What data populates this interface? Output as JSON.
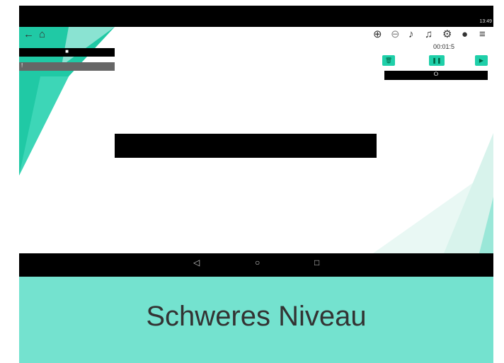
{
  "status_bar": {
    "time": "13:49"
  },
  "toolbar": {
    "timer": "00:01:5",
    "left_bar1_mark": "■",
    "left_bar2_mark": "!",
    "right_bar_mark": "⭘",
    "icons": [
      "back-arrow-icon",
      "home-icon",
      "zoom-in-icon",
      "zoom-out-icon",
      "bell-icon",
      "sound-icon",
      "gear-icon",
      "account-icon",
      "menu-icon"
    ]
  },
  "controls": {
    "trash_label": "🗑",
    "pause_label": "❚❚",
    "play_label": "▶"
  },
  "android_nav": {
    "back": "◁",
    "home": "○",
    "recents": "□"
  },
  "banner": {
    "text": "Schweres Niveau"
  },
  "colors": {
    "accent": "#1fcfa9",
    "banner": "#74e2cf"
  }
}
